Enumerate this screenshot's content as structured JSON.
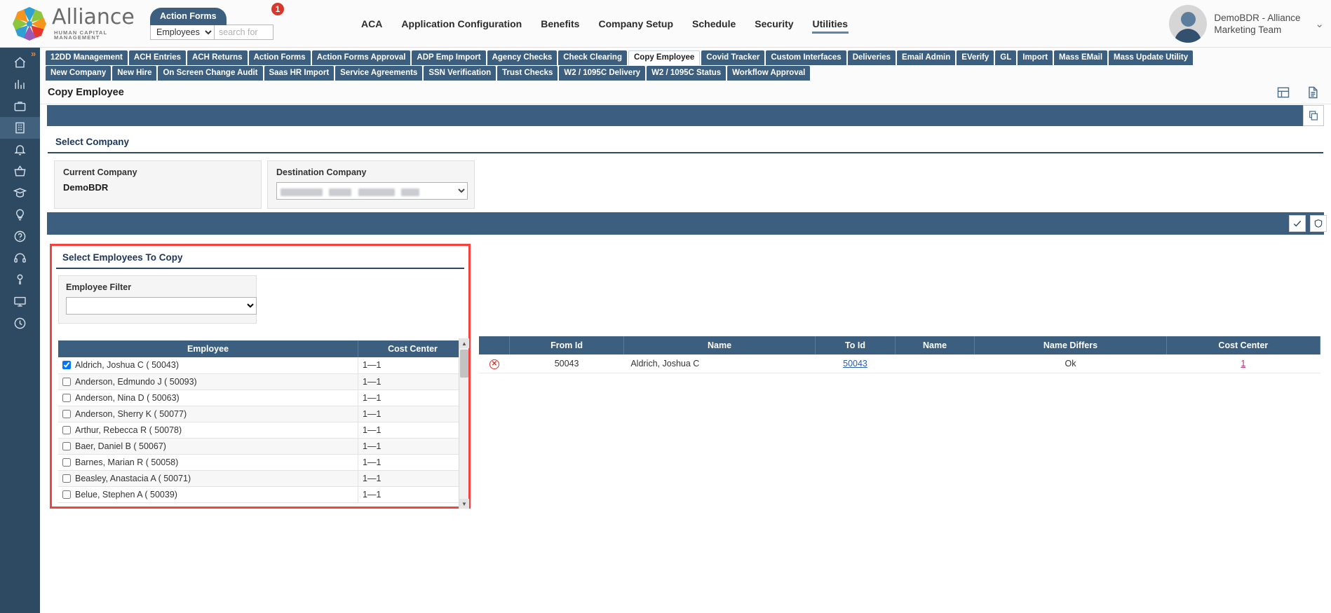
{
  "brand": {
    "name": "Alliance",
    "tagline": "HUMAN CAPITAL MANAGEMENT"
  },
  "header": {
    "action_forms_button": "Action Forms",
    "action_forms_badge": "1",
    "search_scope": "Employees",
    "search_placeholder": "search for",
    "main_nav": [
      {
        "label": "ACA",
        "active": false
      },
      {
        "label": "Application Configuration",
        "active": false
      },
      {
        "label": "Benefits",
        "active": false
      },
      {
        "label": "Company Setup",
        "active": false
      },
      {
        "label": "Schedule",
        "active": false
      },
      {
        "label": "Security",
        "active": false
      },
      {
        "label": "Utilities",
        "active": true
      }
    ],
    "user_name": "DemoBDR - Alliance Marketing Team",
    "user_caret": "chevron-down"
  },
  "sidebar": {
    "items": [
      {
        "icon": "home-icon",
        "active": false
      },
      {
        "icon": "analytics-icon",
        "active": false
      },
      {
        "icon": "briefcase-icon",
        "active": false
      },
      {
        "icon": "building-icon",
        "active": true
      },
      {
        "icon": "bell-icon",
        "active": false
      },
      {
        "icon": "basket-icon",
        "active": false
      },
      {
        "icon": "graduation-icon",
        "active": false
      },
      {
        "icon": "lightbulb-icon",
        "active": false
      },
      {
        "icon": "help-icon",
        "active": false
      },
      {
        "icon": "headset-icon",
        "active": false
      },
      {
        "icon": "key-icon",
        "active": false
      },
      {
        "icon": "monitor-icon",
        "active": false
      },
      {
        "icon": "clock-icon",
        "active": false
      }
    ],
    "expand_arrow": "»"
  },
  "tabs": {
    "row1": [
      {
        "label": "12DD Management",
        "active": false
      },
      {
        "label": "ACH Entries",
        "active": false
      },
      {
        "label": "ACH Returns",
        "active": false
      },
      {
        "label": "Action Forms",
        "active": false
      },
      {
        "label": "Action Forms Approval",
        "active": false
      },
      {
        "label": "ADP Emp Import",
        "active": false
      },
      {
        "label": "Agency Checks",
        "active": false
      },
      {
        "label": "Check Clearing",
        "active": false
      },
      {
        "label": "Copy Employee",
        "active": true
      },
      {
        "label": "Covid Tracker",
        "active": false
      },
      {
        "label": "Custom Interfaces",
        "active": false
      },
      {
        "label": "Deliveries",
        "active": false
      },
      {
        "label": "Email Admin",
        "active": false
      },
      {
        "label": "EVerify",
        "active": false
      },
      {
        "label": "GL",
        "active": false
      },
      {
        "label": "Import",
        "active": false
      },
      {
        "label": "Mass EMail",
        "active": false
      },
      {
        "label": "Mass Update Utility",
        "active": false
      }
    ],
    "row2": [
      {
        "label": "New Company",
        "active": false
      },
      {
        "label": "New Hire",
        "active": false
      },
      {
        "label": "On Screen Change Audit",
        "active": false
      },
      {
        "label": "Saas HR Import",
        "active": false
      },
      {
        "label": "Service Agreements",
        "active": false
      },
      {
        "label": "SSN Verification",
        "active": false
      },
      {
        "label": "Trust Checks",
        "active": false
      },
      {
        "label": "W2 / 1095C Delivery",
        "active": false
      },
      {
        "label": "W2 / 1095C Status",
        "active": false
      },
      {
        "label": "Workflow Approval",
        "active": false
      }
    ]
  },
  "page": {
    "title": "Copy Employee",
    "header_icons": [
      "grid-icon",
      "document-icon"
    ],
    "band1_icon": "copy-icon",
    "band2_icons": [
      "check-icon",
      "shield-icon"
    ]
  },
  "select_company": {
    "section_title": "Select Company",
    "current_label": "Current Company",
    "current_value": "DemoBDR",
    "destination_label": "Destination Company",
    "destination_value": ""
  },
  "select_employees": {
    "section_title": "Select Employees To Copy",
    "filter_label": "Employee Filter",
    "filter_value": "",
    "columns": [
      "Employee",
      "Cost Center"
    ],
    "rows": [
      {
        "checked": true,
        "name": "Aldrich, Joshua C ( 50043)",
        "cost_center": "1—1"
      },
      {
        "checked": false,
        "name": "Anderson, Edmundo J ( 50093)",
        "cost_center": "1—1"
      },
      {
        "checked": false,
        "name": "Anderson, Nina D ( 50063)",
        "cost_center": "1—1"
      },
      {
        "checked": false,
        "name": "Anderson, Sherry K ( 50077)",
        "cost_center": "1—1"
      },
      {
        "checked": false,
        "name": "Arthur, Rebecca R ( 50078)",
        "cost_center": "1—1"
      },
      {
        "checked": false,
        "name": "Baer, Daniel B ( 50067)",
        "cost_center": "1—1"
      },
      {
        "checked": false,
        "name": "Barnes, Marian R ( 50058)",
        "cost_center": "1—1"
      },
      {
        "checked": false,
        "name": "Beasley, Anastacia A ( 50071)",
        "cost_center": "1—1"
      },
      {
        "checked": false,
        "name": "Belue, Stephen A ( 50039)",
        "cost_center": "1—1"
      }
    ]
  },
  "results": {
    "columns": [
      "",
      "From Id",
      "Name",
      "To Id",
      "Name",
      "Name Differs",
      "Cost Center"
    ],
    "rows": [
      {
        "delete_icon": "remove-circle-icon",
        "from_id": "50043",
        "name": "Aldrich, Joshua C",
        "to_id": "50043",
        "to_name": "",
        "name_differs": "Ok",
        "cost_center": "1"
      }
    ]
  },
  "colors": {
    "brand_blue": "#3c5f7f",
    "sidebar_blue": "#2e4a63",
    "highlight_red": "#f8403c",
    "badge_red": "#d9362c",
    "link_blue": "#2a5db0",
    "link_pink": "#b0367c"
  }
}
